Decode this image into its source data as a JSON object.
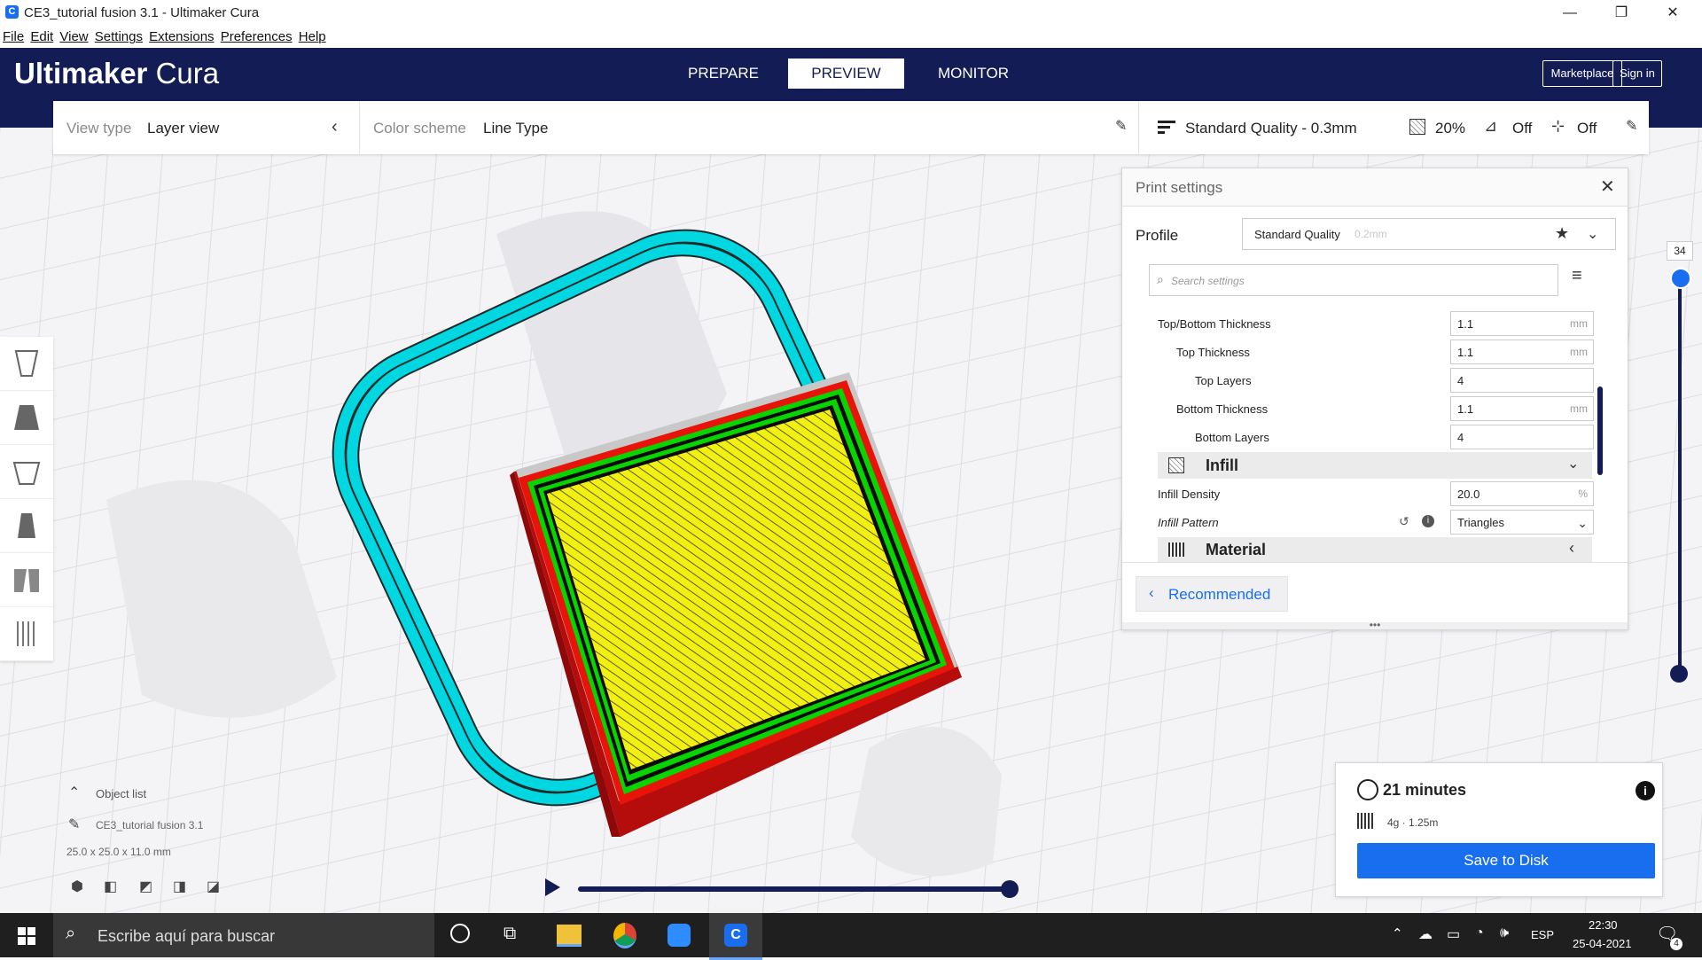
{
  "window": {
    "title": "CE3_tutorial fusion 3.1 - Ultimaker Cura",
    "minimize": "—",
    "restore": "❐",
    "close": "✕"
  },
  "menu": [
    "File",
    "Edit",
    "View",
    "Settings",
    "Extensions",
    "Preferences",
    "Help"
  ],
  "header": {
    "logo_bold": "Ultimaker",
    "logo_light": "Cura",
    "tabs": [
      "PREPARE",
      "PREVIEW",
      "MONITOR"
    ],
    "active_tab": "PREVIEW",
    "marketplace": "Marketplace",
    "sign_in": "Sign in"
  },
  "view_bar": {
    "view_type_label": "View type",
    "view_type_value": "Layer view",
    "color_scheme_label": "Color scheme",
    "color_scheme_value": "Line Type",
    "quality": "Standard Quality - 0.3mm",
    "infill": "20%",
    "support": "Off",
    "adhesion": "Off"
  },
  "print_settings": {
    "title": "Print settings",
    "profile_label": "Profile",
    "profile_value": "Standard Quality",
    "profile_sub": "0.2mm",
    "search_placeholder": "Search settings",
    "rows": [
      {
        "label": "Top/Bottom Thickness",
        "value": "1.1",
        "unit": "mm"
      },
      {
        "label": "Top Thickness",
        "value": "1.1",
        "unit": "mm"
      },
      {
        "label": "Top Layers",
        "value": "4",
        "unit": ""
      },
      {
        "label": "Bottom Thickness",
        "value": "1.1",
        "unit": "mm"
      },
      {
        "label": "Bottom Layers",
        "value": "4",
        "unit": ""
      }
    ],
    "infill_category": "Infill",
    "infill_density_label": "Infill Density",
    "infill_density_value": "20.0",
    "infill_density_unit": "%",
    "infill_pattern_label": "Infill Pattern",
    "infill_pattern_value": "Triangles",
    "material_category": "Material",
    "recommended": "Recommended"
  },
  "layer_slider": {
    "value": "34"
  },
  "object_list": {
    "title": "Object list",
    "object_name": "CE3_tutorial fusion 3.1",
    "dimensions": "25.0 x 25.0 x 11.0 mm"
  },
  "estimate": {
    "time": "21 minutes",
    "material": "4g · 1.25m",
    "save": "Save to Disk"
  },
  "taskbar": {
    "search": "Escribe aquí para buscar",
    "lang": "ESP",
    "time": "22:30",
    "date": "25-04-2021",
    "notifications": "4"
  },
  "colors": {
    "header_bg": "#131c55",
    "accent": "#196ef0",
    "travel": "#00d7e0",
    "wall_outer": "#e8140a",
    "wall_inner": "#08d400",
    "infill": "#f2ef12"
  }
}
